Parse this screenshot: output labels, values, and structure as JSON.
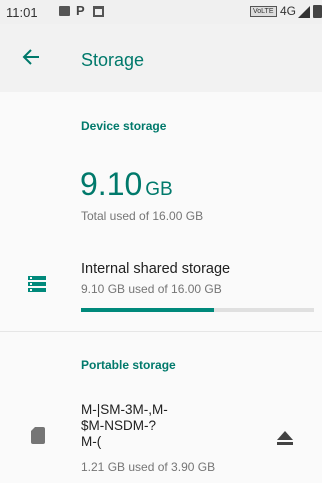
{
  "status_bar": {
    "time": "11:01",
    "volte": "VoLTE",
    "network": "4G"
  },
  "header": {
    "title": "Storage"
  },
  "device_storage": {
    "heading": "Device storage",
    "used_value": "9.10",
    "used_unit": "GB",
    "summary": "Total used of 16.00 GB"
  },
  "internal_storage": {
    "title": "Internal shared storage",
    "detail": "9.10 GB used of 16.00 GB",
    "used_fraction": 0.569
  },
  "portable_storage": {
    "heading": "Portable storage",
    "name": "M-|SM-3M-,M-\n$M-NSDM-?\nM-(",
    "detail": "1.21 GB used of 3.90 GB"
  },
  "colors": {
    "accent": "#00796b",
    "progress": "#00897b"
  }
}
